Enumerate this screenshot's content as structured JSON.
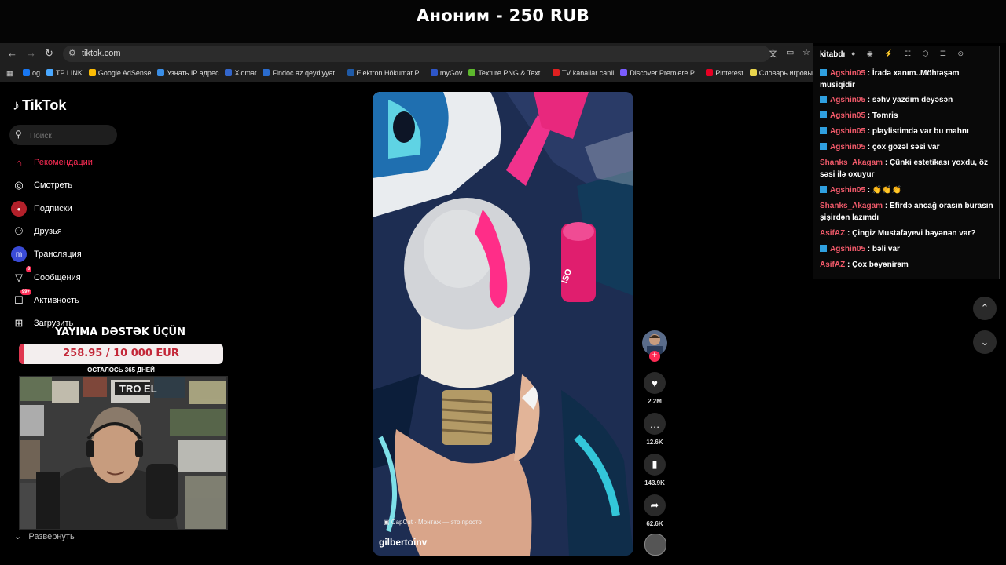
{
  "banner": {
    "title": "Аноним - 250 RUB"
  },
  "browser": {
    "url": "tiktok.com",
    "back": "←",
    "forward": "→",
    "reload": "↻",
    "apps_icon": "▦",
    "bookmarks": [
      {
        "label": "og",
        "color": "#1877f2"
      },
      {
        "label": "TP LINK",
        "color": "#4aa8ff"
      },
      {
        "label": "Google AdSense",
        "color": "#fbbc05"
      },
      {
        "label": "Узнать IP адрес",
        "color": "#3a8ee6"
      },
      {
        "label": "Xidmat",
        "color": "#3366cc"
      },
      {
        "label": "Findoc.az qeydiyyat...",
        "color": "#2a6ccf"
      },
      {
        "label": "Elektron Hökumət P...",
        "color": "#1f5aa6"
      },
      {
        "label": "myGov",
        "color": "#2e56c8"
      },
      {
        "label": "Texture PNG & Text...",
        "color": "#5db82d"
      },
      {
        "label": "TV kanallar canli",
        "color": "#e02020"
      },
      {
        "label": "Discover Premiere P...",
        "color": "#7a5cff"
      },
      {
        "label": "Pinterest",
        "color": "#e60023"
      },
      {
        "label": "Словарь игровых т...",
        "color": "#e8d44d"
      }
    ]
  },
  "tiktok": {
    "logo": "TikTok",
    "search_placeholder": "Поиск",
    "nav": [
      {
        "label": "Рекомендации",
        "icon": "home-icon",
        "glyph": "⌂",
        "active": true
      },
      {
        "label": "Смотреть",
        "icon": "compass-icon",
        "glyph": "◎"
      },
      {
        "label": "Подписки",
        "icon": "following-icon",
        "glyph": "●"
      },
      {
        "label": "Друзья",
        "icon": "friends-icon",
        "glyph": "⚇"
      },
      {
        "label": "Трансляция",
        "icon": "live-icon",
        "glyph": "m"
      },
      {
        "label": "Сообщения",
        "icon": "messages-icon",
        "glyph": "▽",
        "badge": "8"
      },
      {
        "label": "Активность",
        "icon": "activity-icon",
        "glyph": "☐",
        "badge": "99+"
      },
      {
        "label": "Загрузить",
        "icon": "upload-icon",
        "glyph": "⊞"
      }
    ],
    "expand_label": "Развернуть",
    "video": {
      "username": "gilbertoinv",
      "capcut_text": "CapCut · Монтаж — это просто"
    },
    "actions": {
      "likes": "2.2M",
      "comments": "12.6K",
      "saves": "143.9K",
      "shares": "62.6K"
    }
  },
  "donation": {
    "title": "YAYIMA DƏSTƏK ÜÇÜN",
    "amount": "258.95 / 10 000 EUR",
    "progress": 0.0259,
    "days_left": "ОСТАЛОСЬ 365 ДНЕЙ"
  },
  "chat": {
    "title": "kitabdı",
    "messages": [
      {
        "user": "Agshin05",
        "text": "İradə xanım..Möhtəşəm musiqidir",
        "badge": true
      },
      {
        "user": "Agshin05",
        "text": "səhv yazdım deyəsən",
        "badge": true
      },
      {
        "user": "Agshin05",
        "text": "Tomris",
        "badge": true
      },
      {
        "user": "Agshin05",
        "text": "playlistimdə var bu mahnı",
        "badge": true
      },
      {
        "user": "Agshin05",
        "text": "çox gözəl səsi var",
        "badge": true
      },
      {
        "user": "Shanks_Akagam",
        "text": "Çünki estetikası yoxdu, öz səsi ilə oxuyur",
        "badge": false
      },
      {
        "user": "Agshin05",
        "text": "👏👏👏",
        "badge": true
      },
      {
        "user": "Shanks_Akagam",
        "text": "Efirdə ancağ orasın burasın şişirdən lazımdı",
        "badge": false
      },
      {
        "user": "AsifAZ",
        "text": "Çingiz Mustafayevi bəyənən var?",
        "badge": false
      },
      {
        "user": "Agshin05",
        "text": "bəli var",
        "badge": true
      },
      {
        "user": "AsifAZ",
        "text": "Çox bəyənirəm",
        "badge": false
      }
    ]
  },
  "colors": {
    "tiktok_red": "#fe2c55",
    "chat_user": "#f15a6a",
    "twitch_badge": "#2fa0e0",
    "donation_fill": "#e0364f"
  }
}
